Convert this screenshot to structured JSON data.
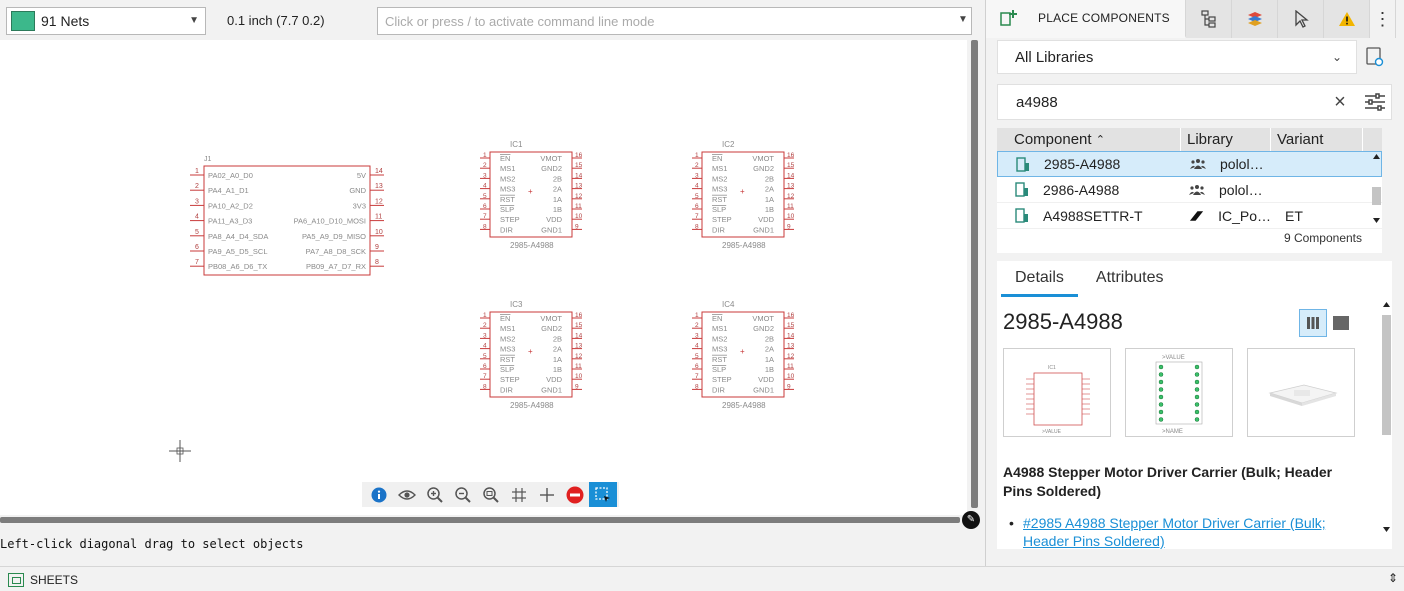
{
  "toolbar": {
    "net_label": "91 Nets",
    "net_color": "#3cb88b",
    "grid_label": "0.1 inch (7.7 0.2)",
    "command_placeholder": "Click or press / to activate command line mode"
  },
  "canvas": {
    "connector": {
      "name": "J1",
      "left_pins": [
        {
          "num": "1",
          "label": "PA02_A0_D0"
        },
        {
          "num": "2",
          "label": "PA4_A1_D1"
        },
        {
          "num": "3",
          "label": "PA10_A2_D2"
        },
        {
          "num": "4",
          "label": "PA11_A3_D3"
        },
        {
          "num": "5",
          "label": "PA8_A4_D4_SDA"
        },
        {
          "num": "6",
          "label": "PA9_A5_D5_SCL"
        },
        {
          "num": "7",
          "label": "PB08_A6_D6_TX"
        }
      ],
      "right_pins": [
        {
          "num": "14",
          "label": "5V"
        },
        {
          "num": "13",
          "label": "GND"
        },
        {
          "num": "12",
          "label": "3V3"
        },
        {
          "num": "11",
          "label": "PA6_A10_D10_MOSI"
        },
        {
          "num": "10",
          "label": "PA5_A9_D9_MISO"
        },
        {
          "num": "9",
          "label": "PA7_A8_D8_SCK"
        },
        {
          "num": "8",
          "label": "PB09_A7_D7_RX"
        }
      ]
    },
    "drivers": [
      {
        "name": "IC1",
        "value": "2985-A4988"
      },
      {
        "name": "IC2",
        "value": "2985-A4988"
      },
      {
        "name": "IC3",
        "value": "2985-A4988"
      },
      {
        "name": "IC4",
        "value": "2985-A4988"
      }
    ],
    "driver_left_pins": [
      {
        "num": "1",
        "label": "EN"
      },
      {
        "num": "2",
        "label": "MS1"
      },
      {
        "num": "3",
        "label": "MS2"
      },
      {
        "num": "4",
        "label": "MS3"
      },
      {
        "num": "5",
        "label": "RST"
      },
      {
        "num": "6",
        "label": "SLP"
      },
      {
        "num": "7",
        "label": "STEP"
      },
      {
        "num": "8",
        "label": "DIR"
      }
    ],
    "driver_right_pins": [
      {
        "num": "16",
        "label": "VMOT"
      },
      {
        "num": "15",
        "label": "GND2"
      },
      {
        "num": "14",
        "label": "2B"
      },
      {
        "num": "13",
        "label": "2A"
      },
      {
        "num": "12",
        "label": "1A"
      },
      {
        "num": "11",
        "label": "1B"
      },
      {
        "num": "10",
        "label": "VDD"
      },
      {
        "num": "9",
        "label": "GND1"
      }
    ],
    "zoom_tools": [
      "info-icon",
      "eye-icon",
      "zoom-in-icon",
      "zoom-out-icon",
      "zoom-fit-icon",
      "grid-icon",
      "crosshair-icon",
      "stop-icon",
      "select-icon"
    ]
  },
  "status": {
    "message": "Left-click diagonal drag to select objects",
    "sheets_label": "SHEETS"
  },
  "panel": {
    "tab_place_label": "PLACE COMPONENTS",
    "library_select": "All Libraries",
    "search_value": "a4988",
    "table": {
      "headers": {
        "component": "Component",
        "library": "Library",
        "variant": "Variant"
      },
      "rows": [
        {
          "component": "2985-A4988",
          "library": "polol…",
          "variant": ""
        },
        {
          "component": "2986-A4988",
          "library": "polol…",
          "variant": ""
        },
        {
          "component": "A4988SETTR-T",
          "library": "IC_Po…",
          "variant": "ET"
        }
      ],
      "count": "9 Components"
    },
    "details": {
      "tabs": [
        "Details",
        "Attributes"
      ],
      "part_name": "2985-A4988",
      "description": "A4988 Stepper Motor Driver Carrier (Bulk; Header Pins Soldered)",
      "link": "#2985 A4988 Stepper Motor Driver Carrier (Bulk; Header Pins Soldered)"
    }
  }
}
